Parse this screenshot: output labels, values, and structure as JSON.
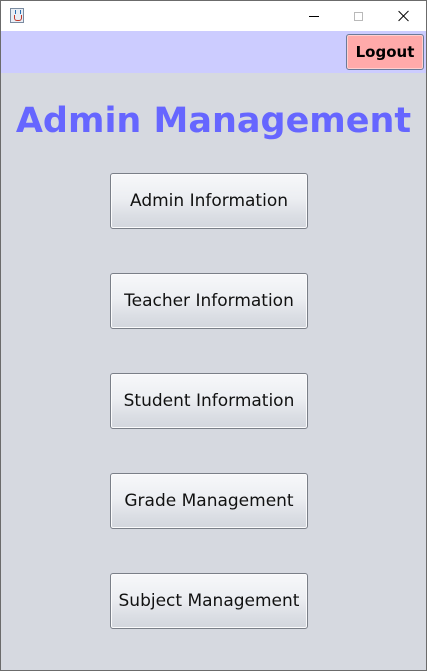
{
  "window": {
    "app_icon": "java-cup-icon",
    "controls": [
      "minimize-icon",
      "maximize-icon",
      "close-icon"
    ]
  },
  "header": {
    "logout_label": "Logout",
    "background": "#ccccff",
    "logout_color": "#ffaaaa"
  },
  "main": {
    "title": "Admin Management",
    "title_color": "#6666ff",
    "buttons": [
      {
        "label": "Admin Information"
      },
      {
        "label": "Teacher Information"
      },
      {
        "label": "Student Information"
      },
      {
        "label": "Grade Management"
      },
      {
        "label": "Subject Management"
      }
    ]
  }
}
